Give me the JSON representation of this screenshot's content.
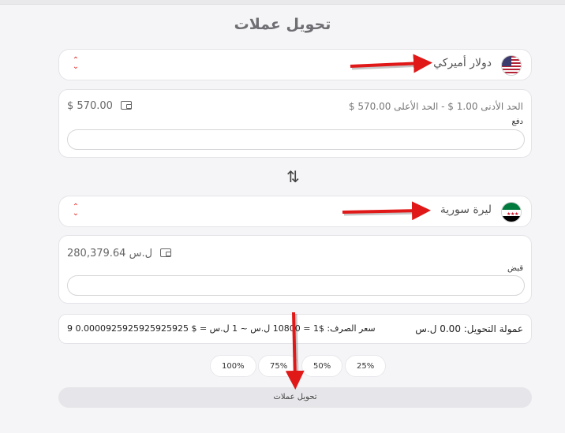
{
  "page": {
    "title": "تحويل عملات"
  },
  "from": {
    "currency_label": "دولار أميركي",
    "flag_icon": "us-flag-icon",
    "balance": "$ 570.00",
    "limits": "الحد الأدنى 1.00 $   -   الحد الأعلى 570.00 $",
    "field_label": "دفع",
    "field_value": ""
  },
  "to": {
    "currency_label": "ليرة سورية",
    "flag_icon": "syria-flag-icon",
    "balance": "ل.س 280,379.64",
    "field_label": "قبض",
    "field_value": ""
  },
  "info": {
    "commission": "عمولة التحويل: 0.00 ل.س",
    "rate": "سعر الصرف: $1 = 10800 ل.س ~ 1 ل.س = $ 0.0000925925925925925 9"
  },
  "percentages": [
    "100%",
    "75%",
    "50%",
    "25%"
  ],
  "submit_label": "تحويل عملات",
  "colors": {
    "accent": "#e02a2a",
    "background": "#f5f5f7",
    "annotation_arrow": "#e01818"
  }
}
